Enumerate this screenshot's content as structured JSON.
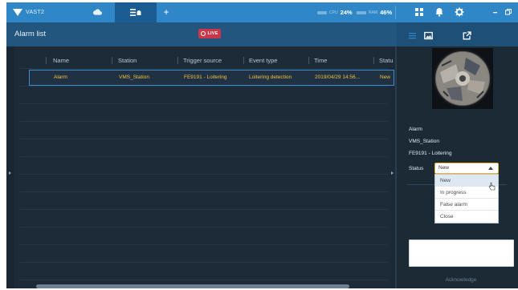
{
  "topbar": {
    "brand": "VAST2",
    "cpu": {
      "label": "CPU",
      "value": "24%"
    },
    "ram": {
      "label": "RAM",
      "value": "46%"
    },
    "icons": [
      "vast-logo-icon",
      "cloud-icon",
      "alarm-list-tab-icon",
      "add-tab-icon",
      "grid-icon",
      "bell-icon",
      "gear-icon",
      "minimize-icon",
      "restore-icon"
    ]
  },
  "titlebar": {
    "title": "Alarm list",
    "live_label": "LIVE",
    "tool_icons": [
      "list-icon",
      "image-icon",
      "export-icon"
    ]
  },
  "table": {
    "columns": [
      "Name",
      "Station",
      "Trigger source",
      "Event type",
      "Time",
      "Statu"
    ],
    "rows": [
      {
        "name": "Alarm",
        "station": "VMS_Station",
        "trigger": "FE9191 - Loitering",
        "event": "Loitering detection",
        "time": "2019/04/29 14:56...",
        "status": "New"
      }
    ]
  },
  "panel": {
    "alarm_name": "Alarm",
    "station": "VMS_Station",
    "source": "FE9191 - Loitering",
    "status_label": "Status",
    "status_value": "New",
    "status_options": [
      "New",
      "In progress",
      "False alarm",
      "Close"
    ],
    "acknowledge": "Acknowledge"
  },
  "colors": {
    "topbar": "#2f87c8",
    "titlebar": "#23567f",
    "background": "#1d2b38",
    "highlight_text": "#f0c341",
    "selection_border": "#3d8fd0",
    "live": "#c8374a",
    "status_focus": "#f0b233"
  }
}
